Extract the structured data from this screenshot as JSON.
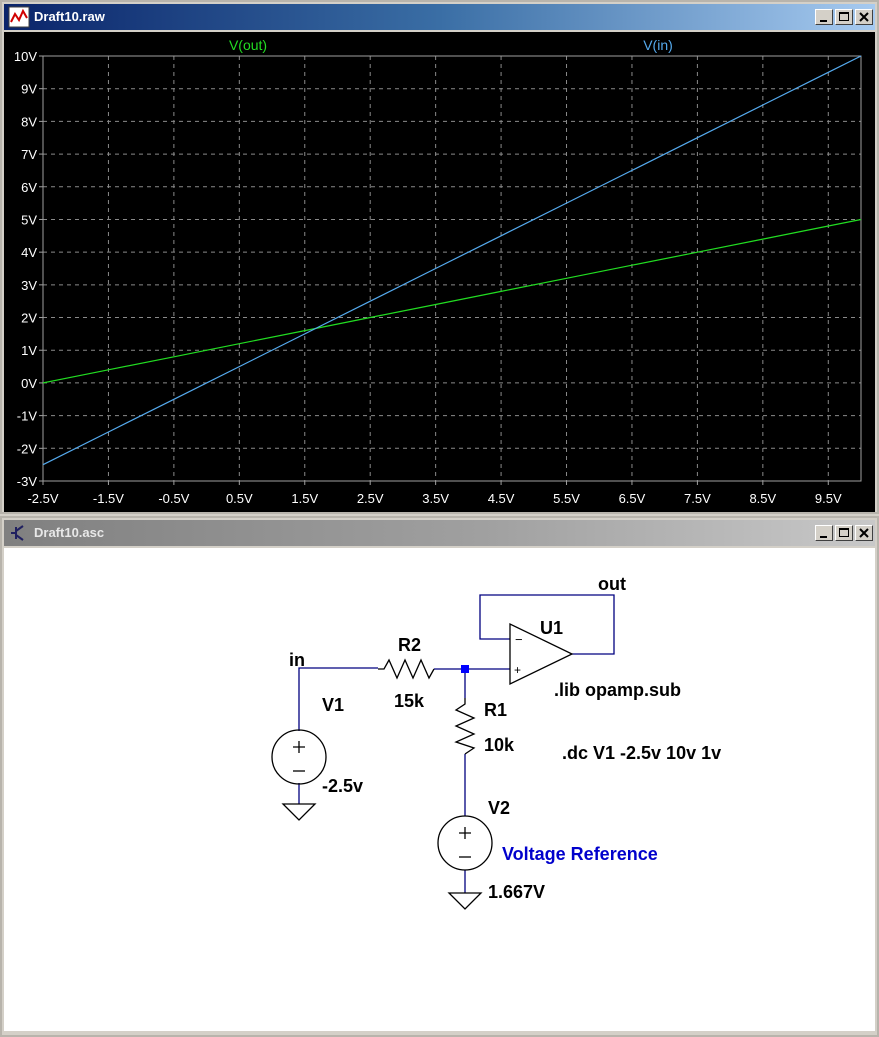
{
  "plot_window": {
    "title": "Draft10.raw",
    "icon": "waveform-icon"
  },
  "schematic_window": {
    "title": "Draft10.asc",
    "icon": "schematic-icon"
  },
  "colors": {
    "vout": "#22dd22",
    "vin": "#55aaee",
    "wire": "#000080",
    "label_blue": "#0000cc"
  },
  "chart_data": {
    "type": "line",
    "x": [
      -2.5,
      -1.5,
      -0.5,
      0.5,
      1.5,
      2.5,
      3.5,
      4.5,
      5.5,
      6.5,
      7.5,
      8.5,
      9.5,
      10
    ],
    "series": [
      {
        "name": "V(out)",
        "values": [
          0.0,
          0.4,
          0.8,
          1.2,
          1.6,
          2.0,
          2.4,
          2.8,
          3.2,
          3.6,
          4.0,
          4.4,
          4.8,
          5.0
        ]
      },
      {
        "name": "V(in)",
        "values": [
          -2.5,
          -1.5,
          -0.5,
          0.5,
          1.5,
          2.5,
          3.5,
          4.5,
          5.5,
          6.5,
          7.5,
          8.5,
          9.5,
          10.0
        ]
      }
    ],
    "xticks": [
      "-2.5V",
      "-1.5V",
      "-0.5V",
      "0.5V",
      "1.5V",
      "2.5V",
      "3.5V",
      "4.5V",
      "5.5V",
      "6.5V",
      "7.5V",
      "8.5V",
      "9.5V"
    ],
    "yticks": [
      "10V",
      "9V",
      "8V",
      "7V",
      "6V",
      "5V",
      "4V",
      "3V",
      "2V",
      "1V",
      "0V",
      "-1V",
      "-2V",
      "-3V"
    ],
    "xlim": [
      -2.5,
      10
    ],
    "ylim": [
      -3,
      10
    ],
    "grid": true
  },
  "schematic": {
    "net_in": "in",
    "net_out": "out",
    "r2_name": "R2",
    "r2_value": "15k",
    "r1_name": "R1",
    "r1_value": "10k",
    "u1_name": "U1",
    "lib": ".lib opamp.sub",
    "dc": ".dc V1 -2.5v 10v 1v",
    "v1_name": "V1",
    "v1_value": "-2.5v",
    "v2_name": "V2",
    "v2_desc": "Voltage Reference",
    "v2_value": "1.667V",
    "plus": "+",
    "minus": "−"
  }
}
